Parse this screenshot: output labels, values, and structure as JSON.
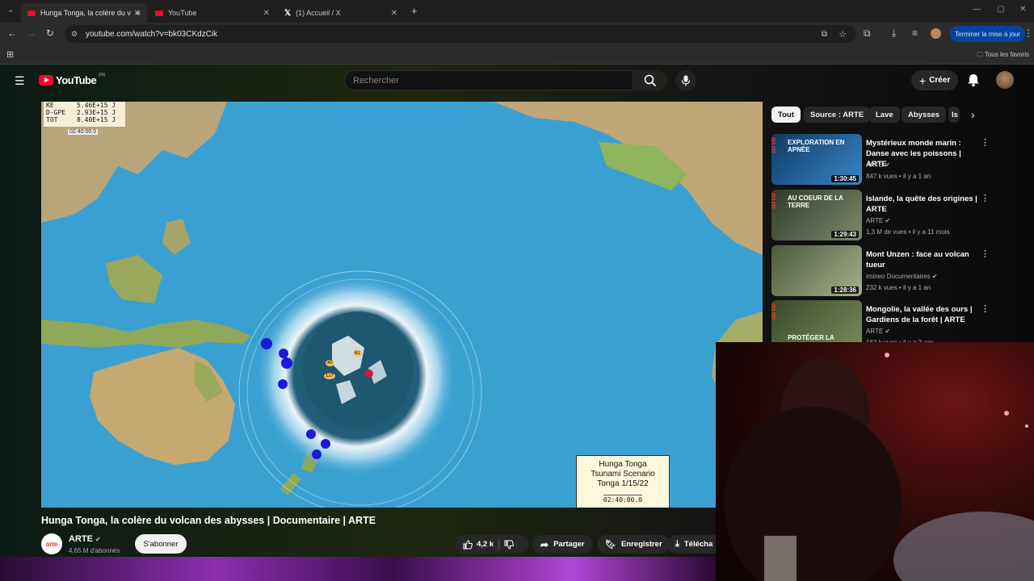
{
  "browser": {
    "tabs": [
      {
        "title": "Hunga Tonga, la colère du v",
        "active": true
      },
      {
        "title": "YouTube",
        "active": false
      },
      {
        "title": "(1) Accueil / X",
        "active": false
      }
    ],
    "url": "youtube.com/watch?v=bk03CKdzCik",
    "update_button": "Terminer la mise à jour",
    "bookmarks_folder": "Tous les favoris"
  },
  "youtube": {
    "logo_text": "YouTube",
    "region": "FR",
    "search_placeholder": "Rechercher",
    "create_label": "Créer"
  },
  "video": {
    "title": "Hunga Tonga, la colère du volcan des abysses | Documentaire | ARTE",
    "legend": [
      {
        "label": "KE",
        "value": "5.46E+15 J"
      },
      {
        "label": "D-GPE",
        "value": "2.93E+15 J"
      },
      {
        "label": "TOT",
        "value": "8.40E+15 J"
      }
    ],
    "legend_time": "02:40:00.0",
    "scenario_lines": [
      "Hunga Tonga",
      "Tsunami Scenario",
      "Tonga 1/15/22"
    ],
    "scenario_time": "02:40:00.0",
    "gauge_labels": [
      "127",
      "40",
      "61"
    ]
  },
  "channel": {
    "logo_text": "arte",
    "name": "ARTE",
    "subscribers": "4,65 M d'abonnés",
    "subscribe_label": "S'abonner"
  },
  "actions": {
    "likes": "4,2 k",
    "share": "Partager",
    "save": "Enregistrer",
    "download": "Télécha"
  },
  "chips": [
    "Tout",
    "Source : ARTE",
    "Lave",
    "Abysses",
    "Is"
  ],
  "recommendations": [
    {
      "thumb_text": "Exploration en apnée",
      "duration": "1:30:45",
      "title": "Mystérieux monde marin : Danse avec les poissons | ARTE",
      "channel": "ARTE",
      "meta": "847 k vues • il y a 1 an",
      "colors": [
        "#0e3a63",
        "#3a86c8"
      ]
    },
    {
      "thumb_text": "Au coeur de la terre",
      "duration": "1:29:43",
      "title": "Islande, la quête des origines | ARTE",
      "channel": "ARTE",
      "meta": "1,3 M de vues • il y a 11 mois",
      "colors": [
        "#2f3b2a",
        "#7d8a6a"
      ]
    },
    {
      "thumb_text": "",
      "duration": "1:28:36",
      "title": "Mont Unzen : face au volcan tueur",
      "channel": "imineo Documentaires",
      "meta": "232 k vues • il y a 1 an",
      "colors": [
        "#4a5a3a",
        "#a8b08a"
      ]
    },
    {
      "thumb_text": "Protéger la",
      "duration": "",
      "title": "Mongolie, la vallée des ours | Gardiens de la forêt | ARTE",
      "channel": "ARTE",
      "meta": "162 k vues • il y a 2 ans",
      "colors": [
        "#3a4a2a",
        "#7a8a5a"
      ]
    }
  ]
}
